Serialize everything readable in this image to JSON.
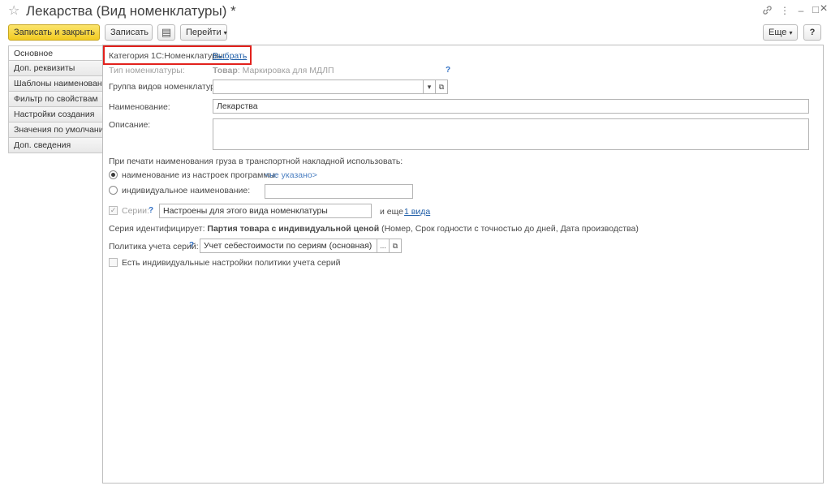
{
  "window": {
    "title": "Лекарства (Вид номенклатуры) *"
  },
  "toolbar": {
    "save_close": "Записать и закрыть",
    "save": "Записать",
    "goto": "Перейти",
    "more": "Еще",
    "help": "?"
  },
  "tabs": [
    {
      "label": "Основное"
    },
    {
      "label": "Доп. реквизиты"
    },
    {
      "label": "Шаблоны наименований"
    },
    {
      "label": "Фильтр по свойствам"
    },
    {
      "label": "Настройки создания"
    },
    {
      "label": "Значения по умолчанию"
    },
    {
      "label": "Доп. сведения"
    }
  ],
  "form": {
    "category_label": "Категория 1С:Номенклатуры:",
    "category_link": "Выбрать",
    "type_label": "Тип номенклатуры:",
    "type_value_bold": "Товар",
    "type_value_rest": ": Маркировка для МДЛП",
    "group_label": "Группа видов номенклатуры:",
    "group_value": "",
    "name_label": "Наименование:",
    "name_value": "Лекарства",
    "desc_label": "Описание:",
    "desc_value": "",
    "print_heading": "При печати наименования груза в транспортной накладной использовать:",
    "radio1_label": "наименование из настроек программы:",
    "radio1_value": "<не указано>",
    "radio2_label": "индивидуальное наименование:",
    "radio2_value": "",
    "series_label": "Серии:",
    "series_value": "Настроены для этого вида номенклатуры",
    "series_more_prefix": "и еще",
    "series_more_link": "1 вида",
    "series_id_prefix": "Серия идентифицирует:",
    "series_id_bold": "Партия товара с индивидуальной ценой",
    "series_id_rest": "(Номер, Срок годности с точностью до дней, Дата производства)",
    "policy_label": "Политика учета серий:",
    "policy_value": "Учет себестоимости по сериям (основная)",
    "individual_check_label": "Есть индивидуальные настройки политики учета серий"
  },
  "icons": {
    "star": "☆",
    "link": "🔗",
    "kebab": "⋮",
    "minimize": "–",
    "maximize": "□",
    "close": "×",
    "report": "▤",
    "dropdown": "▾",
    "open": "⧉",
    "ellipsis": "...",
    "check": "✓"
  }
}
